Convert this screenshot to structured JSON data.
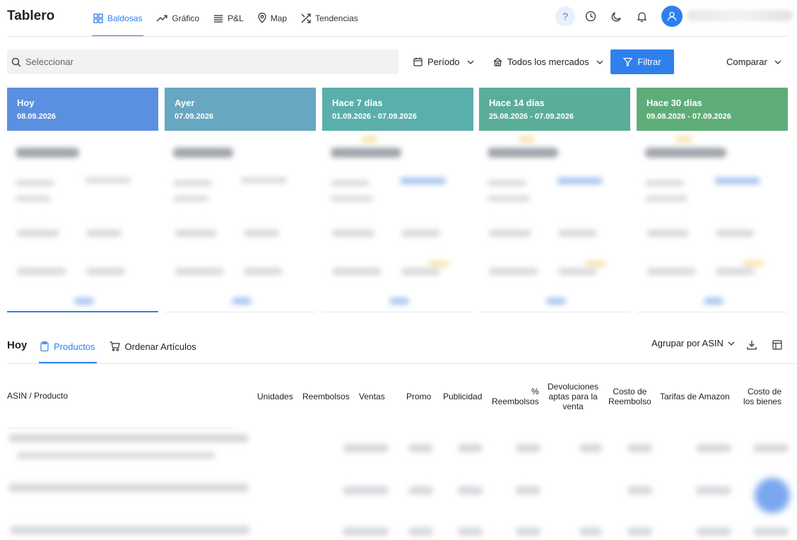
{
  "app": {
    "title": "Tablero"
  },
  "nav": {
    "items": [
      {
        "label": "Baldosas",
        "icon": "grid-icon",
        "active": true
      },
      {
        "label": "Gráfico",
        "icon": "trend-line-icon",
        "active": false
      },
      {
        "label": "P&L",
        "icon": "list-icon",
        "active": false
      },
      {
        "label": "Map",
        "icon": "map-pin-icon",
        "active": false
      },
      {
        "label": "Tendencias",
        "icon": "shuffle-icon",
        "active": false
      }
    ]
  },
  "header_icons": {
    "help": "?",
    "icons": [
      "help-icon",
      "history-clock-icon",
      "moon-icon",
      "bell-icon",
      "user-icon"
    ]
  },
  "filters": {
    "search_placeholder": "Seleccionar",
    "period_label": "Período",
    "markets_label": "Todos los mercados",
    "filter_button": "Filtrar",
    "compare_label": "Comparar"
  },
  "cards": [
    {
      "title": "Hoy",
      "date": "08.09.2026",
      "color": "#5b8fe0"
    },
    {
      "title": "Ayer",
      "date": "07.09.2026",
      "color": "#67a7c1"
    },
    {
      "title": "Hace 7 días",
      "date": "01.09.2026 - 07.09.2026",
      "color": "#5aafab"
    },
    {
      "title": "Hace 14 días",
      "date": "25.08.2026 - 07.09.2026",
      "color": "#5aae99"
    },
    {
      "title": "Hace 30 días",
      "date": "09.08.2026 - 07.09.2026",
      "color": "#5ead79"
    }
  ],
  "section": {
    "title": "Hoy",
    "tabs": [
      {
        "label": "Productos",
        "active": true
      },
      {
        "label": "Ordenar Artículos",
        "active": false
      }
    ],
    "group_by": "Agrupar por ASIN"
  },
  "table": {
    "columns": [
      {
        "label": "ASIN / Producto"
      },
      {
        "label": "Unidades"
      },
      {
        "label": "Reembolsos"
      },
      {
        "label": "Ventas"
      },
      {
        "label": "Promo"
      },
      {
        "label": "Publicidad"
      },
      {
        "label": "% Reembolsos",
        "lines": [
          "%",
          "Reembolsos"
        ]
      },
      {
        "label": "Devoluciones aptas para la venta",
        "lines": [
          "Devoluciones",
          "aptas para la",
          "venta"
        ]
      },
      {
        "label": "Costo de Reembolso",
        "lines": [
          "Costo de",
          "Reembolso"
        ]
      },
      {
        "label": "Tarifas de Amazon"
      },
      {
        "label": "Costo de los bienes",
        "lines": [
          "Costo de",
          "los bienes"
        ]
      }
    ]
  },
  "colors": {
    "accent": "#2f80ed"
  }
}
